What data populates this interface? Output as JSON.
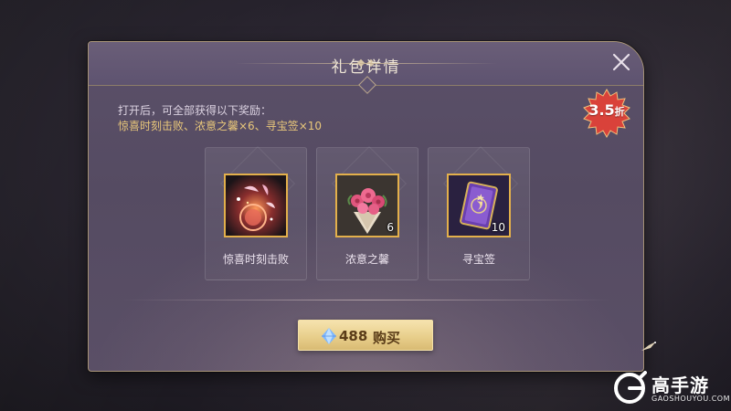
{
  "dialog": {
    "title": "礼包详情",
    "description": "打开后，可全部获得以下奖励：",
    "rewards_summary": "惊喜时刻击败、浓意之馨×6、寻宝签×10"
  },
  "discount": {
    "value": "3.5",
    "unit": "折"
  },
  "items": [
    {
      "name": "惊喜时刻击败",
      "icon": "surprise-moment-icon",
      "quantity": ""
    },
    {
      "name": "浓意之馨",
      "icon": "rose-bouquet-icon",
      "quantity": "6"
    },
    {
      "name": "寻宝签",
      "icon": "treasure-card-icon",
      "quantity": "10"
    }
  ],
  "buy": {
    "price": "488",
    "label": "购买",
    "currency_icon": "diamond-gem-icon"
  },
  "watermark": {
    "brand": "高手游",
    "url": "GAOSHOUYOU.COM"
  },
  "colors": {
    "accent_gold": "#e3b04b",
    "highlight_text": "#e9c77a",
    "badge_red": "#d9423a",
    "button_gold": "#e8cf8c"
  }
}
